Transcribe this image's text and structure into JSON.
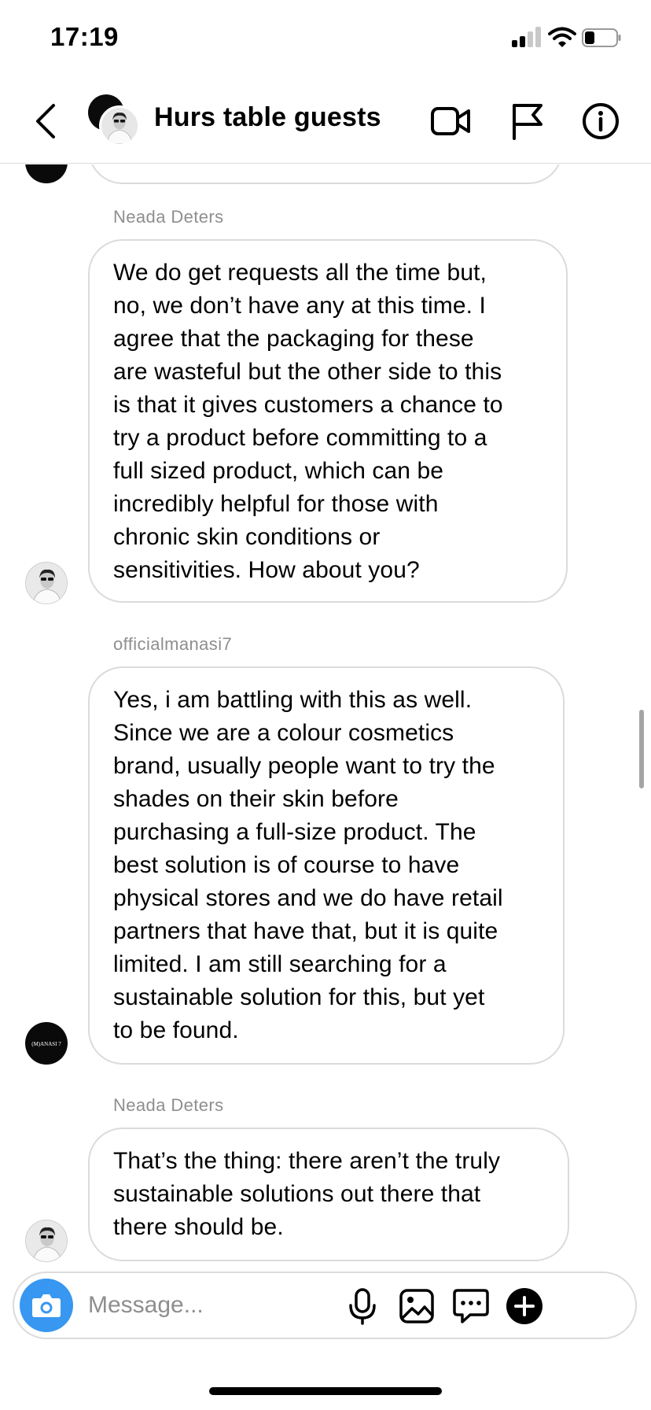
{
  "status_bar": {
    "time": "17:19",
    "icons": [
      "cellular-signal-icon",
      "wifi-icon",
      "battery-icon"
    ]
  },
  "header": {
    "title": "Hurs table guests",
    "icons": {
      "back": "chevron-left-icon",
      "video": "video-camera-icon",
      "report": "flag-icon",
      "info": "info-icon"
    }
  },
  "thread": {
    "messages": [
      {
        "sender": "Neada Deters",
        "avatar": "profile-photo",
        "text": "We do get requests all the time but,\nno, we don’t have any at this time. I\nagree that the packaging for these\nare wasteful but the other side to this\nis that it gives customers a chance to\ntry a product before committing to a\nfull sized product, which can be\nincredibly helpful for those with\nchronic skin conditions or\nsensitivities. How about you?"
      },
      {
        "sender": "officialmanasi7",
        "avatar": "brand-logo",
        "avatar_text": "(M)ANASI 7",
        "text": "Yes, i am battling with this as well.\nSince we are a colour cosmetics\nbrand, usually people want to try the\nshades on their skin before\npurchasing a full-size product. The\nbest solution is of course to have\nphysical stores and we do have retail\npartners that have that, but it is quite\nlimited. I am still searching for a\nsustainable solution for this, but yet\nto be found."
      },
      {
        "sender": "Neada Deters",
        "avatar": "profile-photo",
        "text": "That’s the thing: there aren’t the truly\nsustainable solutions out there that\nthere should be."
      }
    ]
  },
  "composer": {
    "placeholder": "Message...",
    "icons": [
      "camera-icon",
      "microphone-icon",
      "gallery-icon",
      "sticker-icon",
      "plus-icon"
    ]
  },
  "colors": {
    "accent": "#3897f0",
    "bubble_border": "#dbdbdb",
    "secondary_text": "#8e8e8e"
  }
}
